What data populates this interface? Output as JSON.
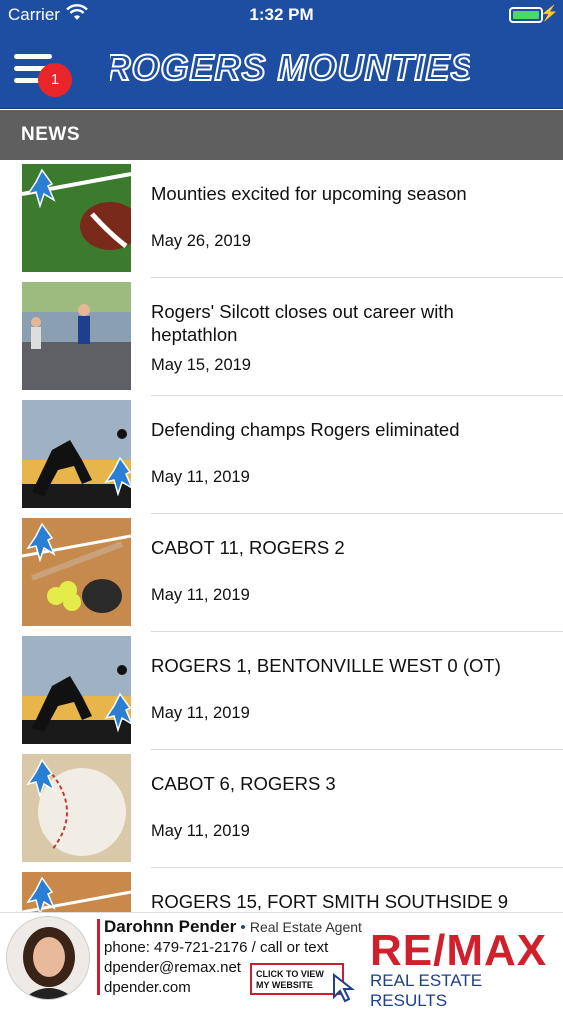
{
  "status_bar": {
    "carrier": "Carrier",
    "time": "1:32 PM"
  },
  "header": {
    "title": "ROGERS MOUNTIES",
    "notification_count": "1"
  },
  "section": {
    "title": "NEWS"
  },
  "news": [
    {
      "title": "Mounties excited for upcoming season",
      "date": "May 26, 2019",
      "image": "football"
    },
    {
      "title": "Rogers' Silcott closes out career with heptathlon",
      "date": "May 15, 2019",
      "image": "track"
    },
    {
      "title": "Defending champs Rogers eliminated",
      "date": "May 11, 2019",
      "image": "soccer"
    },
    {
      "title": "CABOT 11, ROGERS 2",
      "date": "May 11, 2019",
      "image": "softball"
    },
    {
      "title": "ROGERS 1, BENTONVILLE WEST 0 (OT)",
      "date": "May 11, 2019",
      "image": "soccer"
    },
    {
      "title": "CABOT 6, ROGERS 3",
      "date": "May 11, 2019",
      "image": "baseball"
    },
    {
      "title": "ROGERS 15, FORT SMITH SOUTHSIDE 9",
      "date": "",
      "image": "baseball-field"
    }
  ],
  "ad": {
    "name": "Darohnn Pender",
    "role": "Real Estate Agent",
    "phone": "phone: 479-721-2176 / call or text",
    "email": "dpender@remax.net",
    "website": "dpender.com",
    "cta_line1": "CLICK TO VIEW",
    "cta_line2": "MY WEBSITE",
    "logo_main": "RE/MAX",
    "logo_sub": "REAL ESTATE RESULTS"
  },
  "colors": {
    "brand_blue": "#1d4ea2",
    "section_gray": "#5f5f5f",
    "badge_red": "#e8262a",
    "remax_red": "#d0202c"
  }
}
